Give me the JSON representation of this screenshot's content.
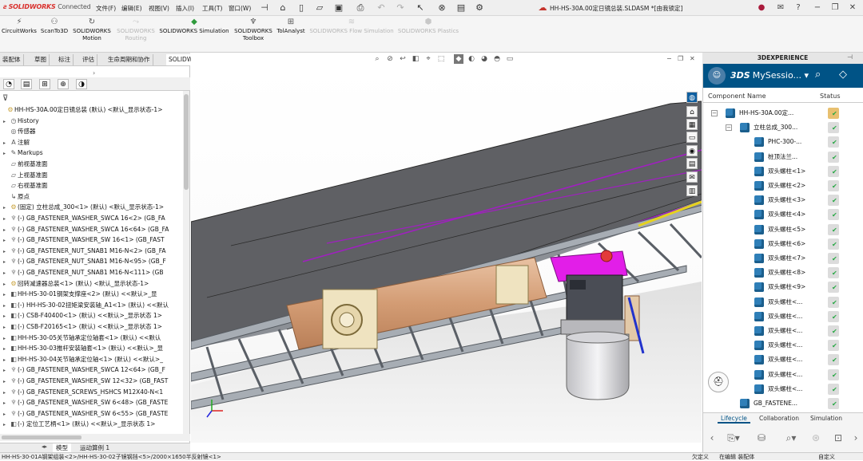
{
  "titlebar": {
    "brand": "SOLIDWORKS",
    "brand_suffix": "Connected",
    "menus": [
      "文件(F)",
      "编辑(E)",
      "视图(V)",
      "插入(I)",
      "工具(T)",
      "窗口(W)"
    ],
    "document_title": "HH-HS-30A.00定日镜总装.SLDASM *[由我锁定]"
  },
  "commands": [
    {
      "label": "CircuitWorks",
      "icon": "circuitworks-icon",
      "enabled": true
    },
    {
      "label": "ScanTo3D",
      "icon": "scanto3d-icon",
      "enabled": true
    },
    {
      "label": "SOLIDWORKS Motion",
      "icon": "motion-icon",
      "enabled": true
    },
    {
      "label": "SOLIDWORKS Routing",
      "icon": "routing-icon",
      "enabled": false
    },
    {
      "label": "SOLIDWORKS Simulation",
      "icon": "simulation-icon",
      "enabled": true
    },
    {
      "label": "SOLIDWORKS Toolbox",
      "icon": "toolbox-icon",
      "enabled": true
    },
    {
      "label": "TolAnalyst",
      "icon": "tolanalyst-icon",
      "enabled": true
    },
    {
      "label": "SOLIDWORKS Flow Simulation",
      "icon": "flow-icon",
      "enabled": false
    },
    {
      "label": "SOLIDWORKS Plastics",
      "icon": "plastics-icon",
      "enabled": false
    }
  ],
  "tabs": [
    "装配体",
    "草图",
    "标注",
    "评估",
    "生命周期和协作",
    "SOLIDWORKS 插件"
  ],
  "tree": [
    {
      "label": "HH-HS-30A.00定日镜总装 (默认) <默认_显示状态-1>",
      "icon": "assembly-icon",
      "indent": 0,
      "arrow": ""
    },
    {
      "label": "History",
      "icon": "history-icon",
      "indent": 1,
      "arrow": "▸"
    },
    {
      "label": "传感器",
      "icon": "sensor-icon",
      "indent": 1,
      "arrow": ""
    },
    {
      "label": "注解",
      "icon": "annotation-icon",
      "indent": 1,
      "arrow": "▸"
    },
    {
      "label": "Markups",
      "icon": "markup-icon",
      "indent": 1,
      "arrow": "▸"
    },
    {
      "label": "前视基准面",
      "icon": "plane-icon",
      "indent": 1,
      "arrow": ""
    },
    {
      "label": "上视基准面",
      "icon": "plane-icon",
      "indent": 1,
      "arrow": ""
    },
    {
      "label": "右视基准面",
      "icon": "plane-icon",
      "indent": 1,
      "arrow": ""
    },
    {
      "label": "原点",
      "icon": "origin-icon",
      "indent": 1,
      "arrow": ""
    },
    {
      "label": "(固定) 立柱总成_300<1> (默认) <默认_显示状态-1>",
      "icon": "assembly-icon",
      "indent": 1,
      "arrow": "▸"
    },
    {
      "label": "(-) GB_FASTENER_WASHER_SWCA 16<2> (GB_FA",
      "icon": "fastener-icon",
      "indent": 1,
      "arrow": "▸"
    },
    {
      "label": "(-) GB_FASTENER_WASHER_SWCA 16<64> (GB_FA",
      "icon": "fastener-icon",
      "indent": 1,
      "arrow": "▸"
    },
    {
      "label": "(-) GB_FASTENER_WASHER_SW 16<1> (GB_FAST",
      "icon": "fastener-icon",
      "indent": 1,
      "arrow": "▸"
    },
    {
      "label": "(-) GB_FASTENER_NUT_SNAB1 M16-N<2> (GB_FA",
      "icon": "fastener-icon",
      "indent": 1,
      "arrow": "▸"
    },
    {
      "label": "(-) GB_FASTENER_NUT_SNAB1 M16-N<95> (GB_F",
      "icon": "fastener-icon",
      "indent": 1,
      "arrow": "▸"
    },
    {
      "label": "(-) GB_FASTENER_NUT_SNAB1 M16-N<111> (GB",
      "icon": "fastener-icon",
      "indent": 1,
      "arrow": "▸"
    },
    {
      "label": "回转减速器总装<1> (默认) <默认_显示状态-1>",
      "icon": "assembly-icon",
      "indent": 1,
      "arrow": "▸"
    },
    {
      "label": "HH-HS-30-01钢架支撑座<2> (默认) <<默认>_显",
      "icon": "part-icon",
      "indent": 1,
      "arrow": "▸"
    },
    {
      "label": "(-) HH-HS-30-02扭矩梁安装轴_A1<1> (默认) <<默认",
      "icon": "part-icon",
      "indent": 1,
      "arrow": "▸"
    },
    {
      "label": "(-) CSB-F40400<1> (默认) <<默认>_显示状态 1>",
      "icon": "part-icon",
      "indent": 1,
      "arrow": "▸"
    },
    {
      "label": "(-) CSB-F20165<1> (默认) <<默认>_显示状态 1>",
      "icon": "part-icon",
      "indent": 1,
      "arrow": "▸"
    },
    {
      "label": "HH-HS-30-05关节轴承定位轴套<1> (默认) <<默认",
      "icon": "part-icon",
      "indent": 1,
      "arrow": "▸"
    },
    {
      "label": "HH-HS-30-03推杆安装轴套<1> (默认) <<默认>_显",
      "icon": "part-icon",
      "indent": 1,
      "arrow": "▸"
    },
    {
      "label": "HH-HS-30-04关节轴承定位轴<1> (默认) <<默认>_",
      "icon": "part-icon",
      "indent": 1,
      "arrow": "▸"
    },
    {
      "label": "(-) GB_FASTENER_WASHER_SWCA 12<64> (GB_F",
      "icon": "fastener-icon",
      "indent": 1,
      "arrow": "▸"
    },
    {
      "label": "(-) GB_FASTENER_WASHER_SW 12<32> (GB_FAST",
      "icon": "fastener-icon",
      "indent": 1,
      "arrow": "▸"
    },
    {
      "label": "(-) GB_FASTENER_SCREWS_HSHCS M12X40-N<1",
      "icon": "fastener-icon",
      "indent": 1,
      "arrow": "▸"
    },
    {
      "label": "(-) GB_FASTENER_WASHER_SW 6<48> (GB_FASTE",
      "icon": "fastener-icon",
      "indent": 1,
      "arrow": "▸"
    },
    {
      "label": "(-) GB_FASTENER_WASHER_SW 6<55> (GB_FASTE",
      "icon": "fastener-icon",
      "indent": 1,
      "arrow": "▸"
    },
    {
      "label": "(-) 定位工艺柄<1> (默认) <<默认>_显示状态 1>",
      "icon": "part-icon",
      "indent": 1,
      "arrow": "▸"
    }
  ],
  "bottom_tabs": [
    "模型",
    "运动算例 1"
  ],
  "statusbar": {
    "path": "HH-HS-30-01A钢架组装<2>/HH-HS-30-02子镜钢挡<5>/2000×1650半反射镜<1>",
    "mode": "欠定义",
    "edit": "在编辑 装配体",
    "custom": "自定义"
  },
  "right_panel": {
    "title": "3DEXPERIENCE",
    "brand": "3DS",
    "session": "MySessio...",
    "col_name": "Component Name",
    "col_status": "Status",
    "rows": [
      {
        "name": "HH-HS-30A.00定...",
        "level": 0,
        "expander": "−"
      },
      {
        "name": "立柱总成_300...",
        "level": 1,
        "expander": "−"
      },
      {
        "name": "PHC-300-...",
        "level": 2,
        "expander": ""
      },
      {
        "name": "桩顶法兰...",
        "level": 2,
        "expander": ""
      },
      {
        "name": "双头螺柱<1>",
        "level": 2,
        "expander": ""
      },
      {
        "name": "双头螺柱<2>",
        "level": 2,
        "expander": ""
      },
      {
        "name": "双头螺柱<3>",
        "level": 2,
        "expander": ""
      },
      {
        "name": "双头螺柱<4>",
        "level": 2,
        "expander": ""
      },
      {
        "name": "双头螺柱<5>",
        "level": 2,
        "expander": ""
      },
      {
        "name": "双头螺柱<6>",
        "level": 2,
        "expander": ""
      },
      {
        "name": "双头螺柱<7>",
        "level": 2,
        "expander": ""
      },
      {
        "name": "双头螺柱<8>",
        "level": 2,
        "expander": ""
      },
      {
        "name": "双头螺柱<9>",
        "level": 2,
        "expander": ""
      },
      {
        "name": "双头螺柱<...",
        "level": 2,
        "expander": ""
      },
      {
        "name": "双头螺柱<...",
        "level": 2,
        "expander": ""
      },
      {
        "name": "双头螺柱<...",
        "level": 2,
        "expander": ""
      },
      {
        "name": "双头螺柱<...",
        "level": 2,
        "expander": ""
      },
      {
        "name": "双头螺柱<...",
        "level": 2,
        "expander": ""
      },
      {
        "name": "双头螺柱<...",
        "level": 2,
        "expander": ""
      },
      {
        "name": "双头螺柱<...",
        "level": 2,
        "expander": ""
      },
      {
        "name": "GB_FASTENE...",
        "level": 1,
        "expander": ""
      }
    ],
    "bottom_tabs": [
      "Lifecycle",
      "Collaboration",
      "Simulation"
    ]
  },
  "colors": {
    "accent": "#005386",
    "panel_dark": "#5a5a5e",
    "frame": "#8a8f96",
    "bronze": "#d2a07a",
    "magenta": "#e21ee8",
    "brace": "#a020c0"
  }
}
